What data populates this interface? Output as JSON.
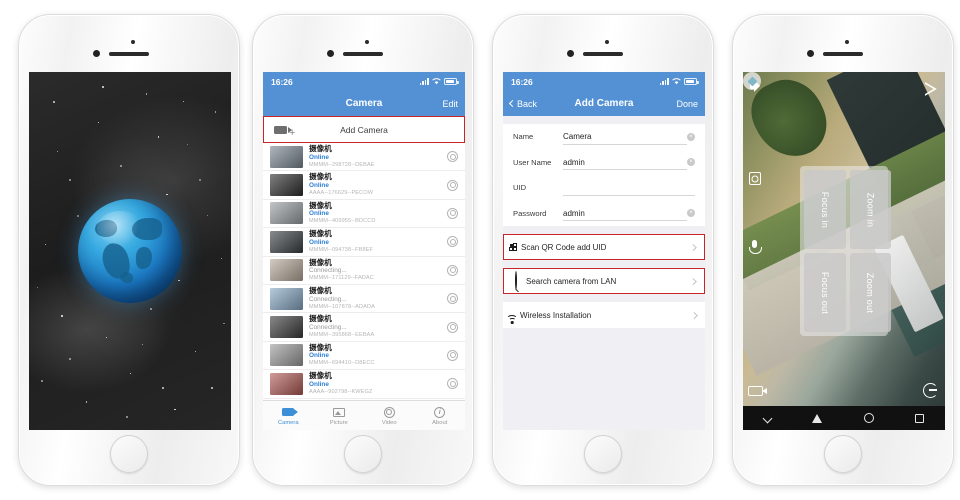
{
  "phones": [
    {
      "id": "splash-screen",
      "screen_type": "splash",
      "description": "globe-splash"
    },
    {
      "id": "camera-list-screen",
      "screen_type": "camera-list",
      "statusbar": {
        "time": "16:26"
      },
      "navbar": {
        "title": "Camera",
        "right_label": "Edit"
      },
      "add_camera": {
        "label": "Add Camera",
        "icon": "camera-plus-icon"
      },
      "cameras": [
        {
          "name": "摄像机",
          "status": "Online",
          "status_kind": "online",
          "uid": "MMMM--298728--DEBAE"
        },
        {
          "name": "摄像机",
          "status": "Online",
          "status_kind": "online",
          "uid": "AAAA--176629--PECOW"
        },
        {
          "name": "摄像机",
          "status": "Online",
          "status_kind": "online",
          "uid": "MMMM--409955--BDCCD"
        },
        {
          "name": "摄像机",
          "status": "Online",
          "status_kind": "online",
          "uid": "MMMM--094738--FB8EF"
        },
        {
          "name": "摄像机",
          "status": "Connecting...",
          "status_kind": "connecting",
          "uid": "MMMM--171129--FADAC"
        },
        {
          "name": "摄像机",
          "status": "Connecting...",
          "status_kind": "connecting",
          "uid": "MMMM--107878--ADADA"
        },
        {
          "name": "摄像机",
          "status": "Connecting...",
          "status_kind": "connecting",
          "uid": "MMMM--395868--EEBAA"
        },
        {
          "name": "摄像机",
          "status": "Online",
          "status_kind": "online",
          "uid": "MMMM--694410--D8ECC"
        },
        {
          "name": "摄像机",
          "status": "Online",
          "status_kind": "online",
          "uid": "AAAA--902798--KWEGZ"
        }
      ],
      "tabs": [
        {
          "label": "Camera",
          "icon": "camera-icon",
          "active": true
        },
        {
          "label": "Picture",
          "icon": "picture-icon",
          "active": false
        },
        {
          "label": "Video",
          "icon": "video-icon",
          "active": false
        },
        {
          "label": "About",
          "icon": "info-icon",
          "active": false
        }
      ]
    },
    {
      "id": "add-camera-screen",
      "screen_type": "add-camera",
      "statusbar": {
        "time": "16:26"
      },
      "navbar": {
        "back_label": "Back",
        "title": "Add Camera",
        "right_label": "Done"
      },
      "fields": [
        {
          "label": "Name",
          "value": "Camera",
          "clearable": true
        },
        {
          "label": "User Name",
          "value": "admin",
          "clearable": true
        },
        {
          "label": "UID",
          "value": "",
          "clearable": false
        },
        {
          "label": "Password",
          "value": "admin",
          "clearable": true
        }
      ],
      "actions": [
        {
          "label": "Scan QR Code add UID",
          "icon": "qr-code-icon",
          "highlighted": true
        },
        {
          "label": "Search camera from LAN",
          "icon": "search-icon",
          "highlighted": true
        },
        {
          "label": "Wireless Installation",
          "icon": "wifi-icon",
          "highlighted": false
        }
      ]
    },
    {
      "id": "live-view-screen",
      "screen_type": "live-view",
      "controls": [
        {
          "label": "Focus in"
        },
        {
          "label": "Zoom in"
        },
        {
          "label": "Focus out"
        },
        {
          "label": "Zoom out"
        }
      ],
      "overlay_icons": [
        "speaker-icon",
        "snapshot-icon",
        "microphone-icon",
        "record-icon",
        "play-icon",
        "dpad-icon",
        "rotate-icon"
      ],
      "android_nav": [
        "collapse-icon",
        "back-icon",
        "home-icon",
        "recents-icon"
      ]
    }
  ],
  "colors": {
    "header_blue": "#5391d4",
    "accent_blue": "#2e7fd4",
    "highlight_red": "#c8252b",
    "connecting_gray": "#9a9a9a"
  }
}
